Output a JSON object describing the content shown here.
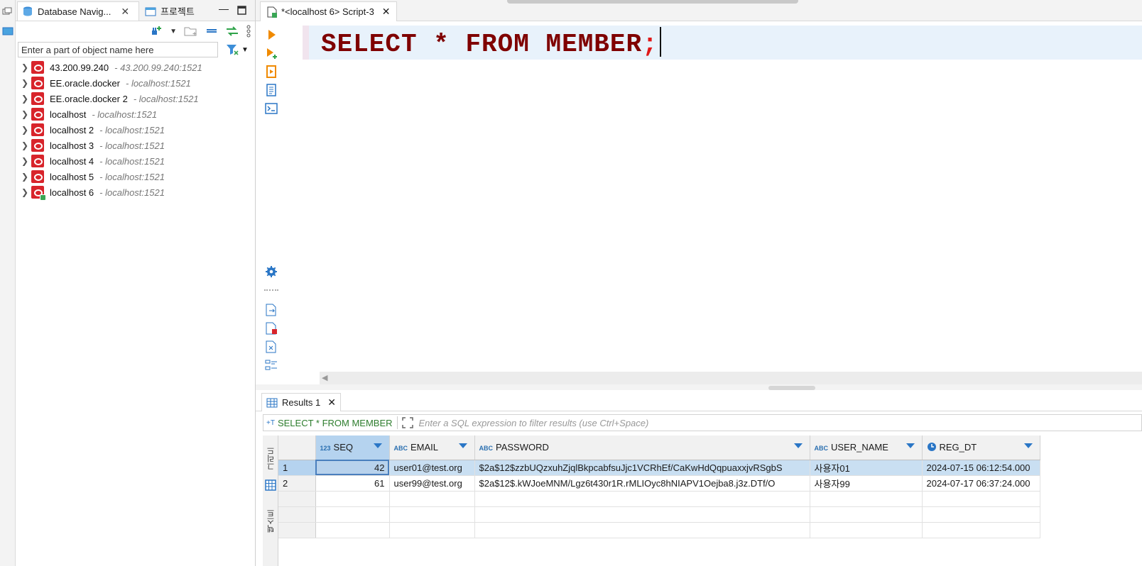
{
  "navigator": {
    "tabs": [
      {
        "label": "Database Navig...",
        "active": true
      },
      {
        "label": "프로젝트",
        "active": false
      }
    ],
    "search_placeholder": "Enter a part of object name here",
    "connections": [
      {
        "name": "43.200.99.240",
        "host": "- 43.200.99.240:1521",
        "connected": false
      },
      {
        "name": "EE.oracle.docker",
        "host": "- localhost:1521",
        "connected": false
      },
      {
        "name": "EE.oracle.docker 2",
        "host": "- localhost:1521",
        "connected": false
      },
      {
        "name": "localhost",
        "host": "- localhost:1521",
        "connected": false
      },
      {
        "name": "localhost 2",
        "host": "- localhost:1521",
        "connected": false
      },
      {
        "name": "localhost 3",
        "host": "- localhost:1521",
        "connected": false
      },
      {
        "name": "localhost 4",
        "host": "- localhost:1521",
        "connected": false
      },
      {
        "name": "localhost 5",
        "host": "- localhost:1521",
        "connected": false
      },
      {
        "name": "localhost 6",
        "host": "- localhost:1521",
        "connected": true
      }
    ]
  },
  "editor": {
    "tab_label": "*<localhost 6> Script-3",
    "sql": {
      "select": "SELECT",
      "star": "*",
      "from": "FROM",
      "table": "MEMBER",
      "semicolon": ";"
    }
  },
  "results": {
    "tab_label": "Results 1",
    "filter_query": "SELECT * FROM MEMBER",
    "filter_placeholder": "Enter a SQL expression to filter results (use Ctrl+Space)",
    "side_tabs": [
      "그리드",
      "텍스트"
    ],
    "columns": [
      {
        "type": "123",
        "name": "SEQ"
      },
      {
        "type": "ABC",
        "name": "EMAIL"
      },
      {
        "type": "ABC",
        "name": "PASSWORD"
      },
      {
        "type": "ABC",
        "name": "USER_NAME"
      },
      {
        "type": "clock",
        "name": "REG_DT"
      }
    ],
    "rows": [
      {
        "row": "1",
        "seq": "42",
        "email": "user01@test.org",
        "password": "$2a$12$zzbUQzxuhZjqlBkpcabfsuJjc1VCRhEf/CaKwHdQqpuaxxjvRSgbS",
        "user_name": "사용자01",
        "reg_dt": "2024-07-15 06:12:54.000"
      },
      {
        "row": "2",
        "seq": "61",
        "email": "user99@test.org",
        "password": "$2a$12$.kWJoeMNM/Lgz6t430r1R.rMLIOyc8hNIAPV1Oejba8.j3z.DTf/O",
        "user_name": "사용자99",
        "reg_dt": "2024-07-17 06:37:24.000"
      }
    ]
  },
  "colors": {
    "sql_keyword": "#7f0000",
    "sql_punct": "#e01818",
    "oracle_red": "#d8242b",
    "selection": "#c9dff2"
  }
}
